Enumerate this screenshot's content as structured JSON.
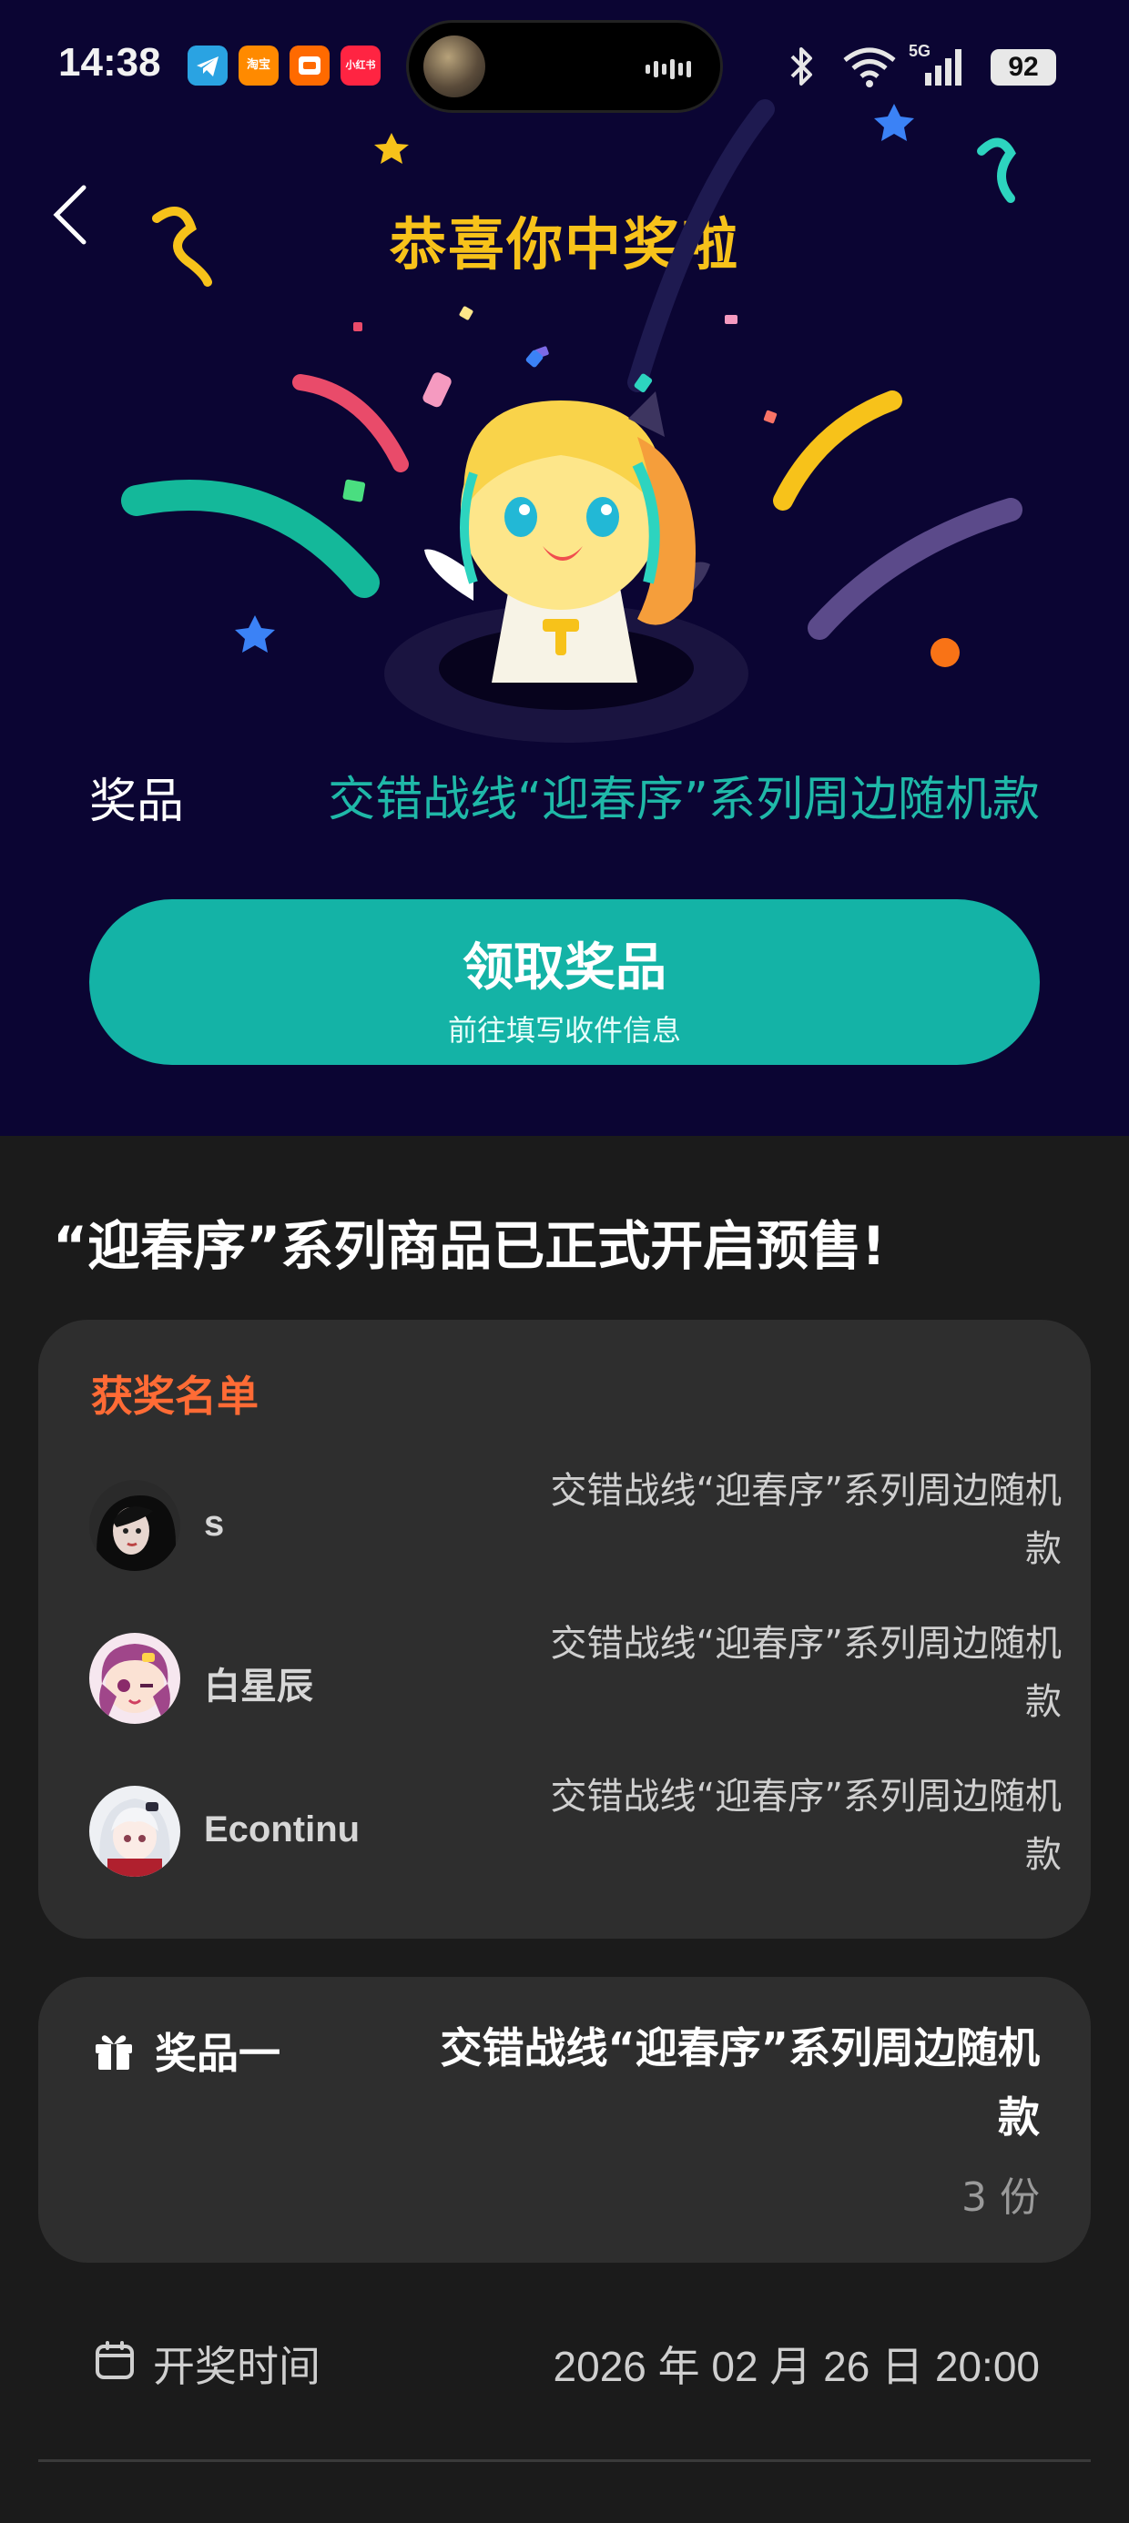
{
  "status_bar": {
    "time": "14:38",
    "battery": "92",
    "network_label": "5G",
    "app_icons": [
      {
        "name": "telegram-icon",
        "color": "#2aa3e2",
        "text": ""
      },
      {
        "name": "taobao-flash-icon",
        "color": "#ff8a00",
        "text": "淘宝"
      },
      {
        "name": "orange-app-icon",
        "color": "#ff6a00",
        "text": ""
      },
      {
        "name": "xiaohongshu-icon",
        "color": "#ff2442",
        "text": "小红书"
      }
    ]
  },
  "banner": {
    "title": "恭喜你中奖啦",
    "prize_label": "奖品",
    "prize_value": "交错战线“迎春序”系列周边随机款",
    "claim_button": {
      "title": "领取奖品",
      "subtitle": "前往填写收件信息"
    }
  },
  "headline": "“迎春序”系列商品已正式开启预售!",
  "winners": {
    "title": "获奖名单",
    "list": [
      {
        "name": "s",
        "prize": "交错战线“迎春序”系列周边随机款",
        "avatar": "dark"
      },
      {
        "name": "白星辰",
        "prize": "交错战线“迎春序”系列周边随机款",
        "avatar": "anime-pink"
      },
      {
        "name": "Econtinu",
        "prize": "交错战线“迎春序”系列周边随机款",
        "avatar": "anime-white"
      }
    ]
  },
  "prize_card": {
    "label": "奖品一",
    "value": "交错战线“迎春序”系列周边随机款",
    "quantity": "3 份"
  },
  "draw_time": {
    "label": "开奖时间",
    "value": "2026 年 02 月 26 日 20:00"
  },
  "colors": {
    "banner_bg": "#0b0533",
    "title_gold": "#f7c21a",
    "accent_teal": "#14b3a6",
    "winners_title": "#ff6b35",
    "card_bg": "#2e2e2e",
    "page_bg": "#1b1b1b"
  }
}
